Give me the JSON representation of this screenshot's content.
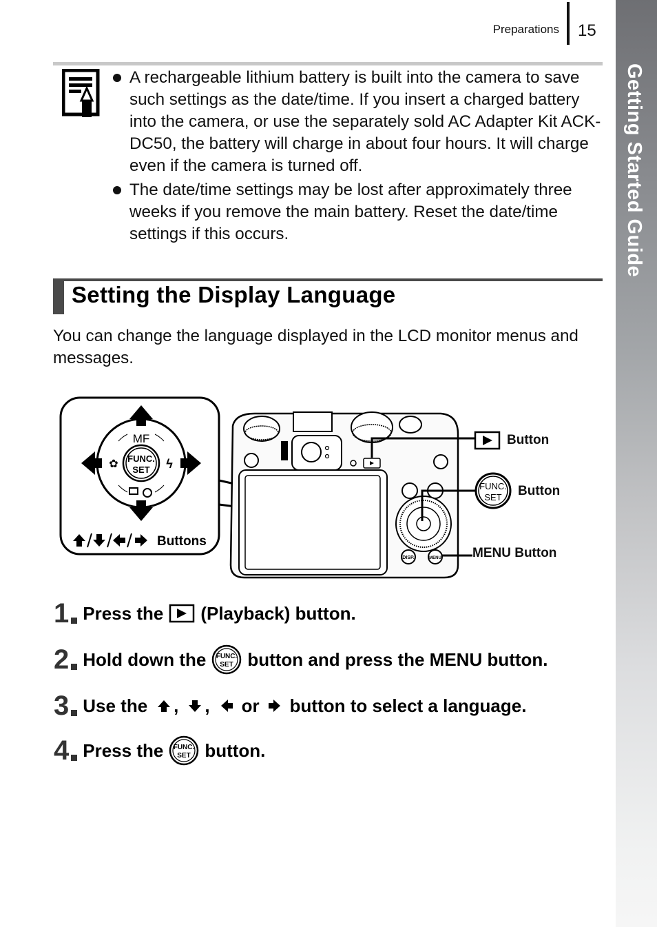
{
  "header": {
    "section_name": "Preparations",
    "page_number": "15"
  },
  "side_tab": {
    "label": "Getting Started Guide"
  },
  "note": {
    "icon": "memo-pencil-icon",
    "bullets": [
      "A rechargeable lithium battery is built into the camera to save such settings as the date/time. If you insert a charged battery into the camera, or use the separately sold AC Adapter Kit ACK-DC50, the battery will charge in about four hours. It will charge even if the camera is turned off.",
      "The date/time settings may be lost after approximately three weeks if you remove the main battery. Reset the date/time settings if this occurs."
    ]
  },
  "section": {
    "title": "Setting the Display Language",
    "intro": "You can change the language displayed in the LCD monitor menus and messages."
  },
  "figure": {
    "dpad_labels": {
      "top": "MF",
      "center_line1": "FUNC.",
      "center_line2": "SET"
    },
    "dpad_caption": "Buttons",
    "callouts": {
      "playback": "Button",
      "func_set": "Button",
      "menu": "MENU Button"
    },
    "func_icon_line1": "FUNC.",
    "func_icon_line2": "SET"
  },
  "steps": [
    {
      "number": "1",
      "before": "Press the",
      "icon": "playback-icon",
      "after": "(Playback) button."
    },
    {
      "number": "2",
      "before": "Hold down the",
      "icon": "func-set-icon",
      "after": "button and press the MENU button."
    },
    {
      "number": "3",
      "before": "Use the",
      "icon": "arrow-keys",
      "sep1": ",",
      "sep2": ",",
      "sep3": "or",
      "after": "button to select a language."
    },
    {
      "number": "4",
      "before": "Press the",
      "icon": "func-set-icon",
      "after": "button."
    }
  ]
}
